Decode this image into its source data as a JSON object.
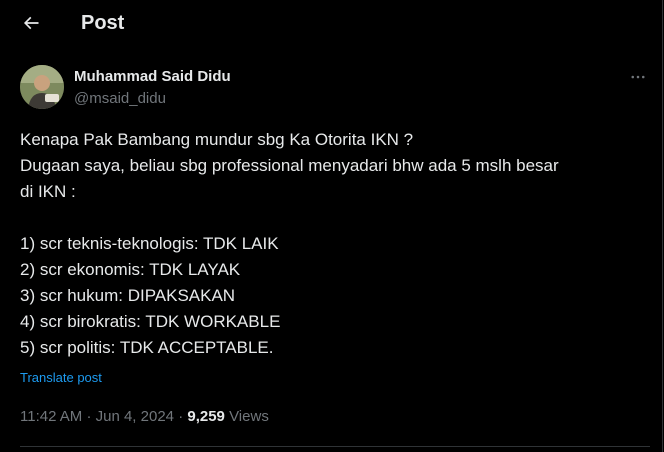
{
  "colors": {
    "background": "#000000",
    "text": "#e7e9ea",
    "secondary_text": "#71767b",
    "link": "#1d9bf0",
    "divider": "#2f3336"
  },
  "header": {
    "back_icon": "arrow-left-icon",
    "title": "Post"
  },
  "author": {
    "display_name": "Muhammad Said Didu",
    "handle": "@msaid_didu",
    "more_icon": "ellipsis-horizontal-icon"
  },
  "tweet": {
    "lines": [
      "Kenapa Pak Bambang mundur sbg Ka Otorita IKN ?",
      "Dugaan saya, beliau sbg professional menyadari bhw ada 5 mslh besar",
      "di IKN :",
      "",
      "1) scr teknis-teknologis: TDK LAIK",
      "2) scr ekonomis: TDK LAYAK",
      "3) scr hukum: DIPAKSAKAN",
      "4) scr birokratis: TDK WORKABLE",
      "5) scr politis: TDK ACCEPTABLE."
    ],
    "translate_label": "Translate post"
  },
  "meta": {
    "time": "11:42 AM",
    "separator": "·",
    "date": "Jun 4, 2024",
    "views_count": "9,259",
    "views_label": "Views"
  }
}
